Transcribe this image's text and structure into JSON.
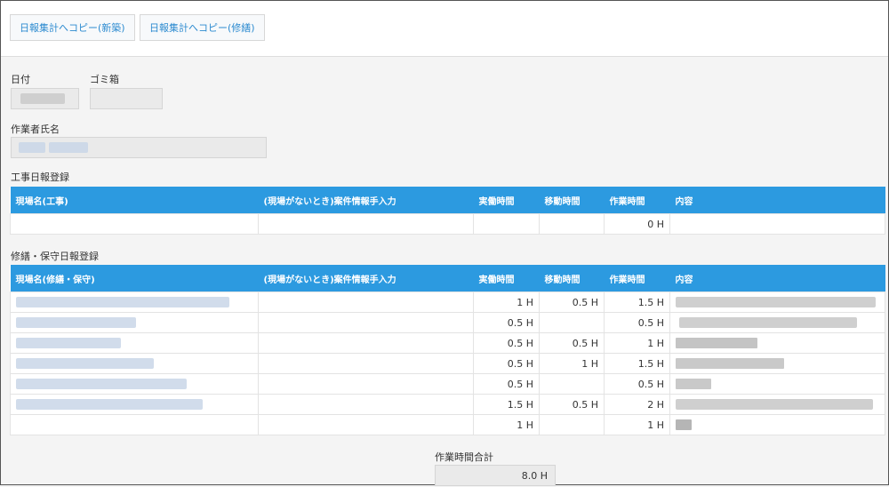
{
  "toolbar": {
    "copy_new_label": "日報集計へコピー(新築)",
    "copy_repair_label": "日報集計へコピー(修繕)"
  },
  "fields": {
    "date_label": "日付",
    "trash_label": "ゴミ箱",
    "worker_label": "作業者氏名"
  },
  "construction": {
    "section_title": "工事日報登録",
    "headers": [
      "現場名(工事)",
      "(現場がないとき)案件情報手入力",
      "実働時間",
      "移動時間",
      "作業時間",
      "内容"
    ],
    "rows": [
      {
        "site": "",
        "manual": "",
        "work": "",
        "move": "",
        "total": "0 H",
        "content": ""
      }
    ]
  },
  "repair": {
    "section_title": "修繕・保守日報登録",
    "headers": [
      "現場名(修繕・保守)",
      "(現場がないとき)案件情報手入力",
      "実働時間",
      "移動時間",
      "作業時間",
      "内容"
    ],
    "rows": [
      {
        "site": "",
        "manual": "",
        "work": "1 H",
        "move": "0.5 H",
        "total": "1.5 H",
        "content": ""
      },
      {
        "site": "",
        "manual": "",
        "work": "0.5 H",
        "move": "",
        "total": "0.5 H",
        "content": ""
      },
      {
        "site": "",
        "manual": "",
        "work": "0.5 H",
        "move": "0.5 H",
        "total": "1 H",
        "content": ""
      },
      {
        "site": "",
        "manual": "",
        "work": "0.5 H",
        "move": "1 H",
        "total": "1.5 H",
        "content": ""
      },
      {
        "site": "",
        "manual": "",
        "work": "0.5 H",
        "move": "",
        "total": "0.5 H",
        "content": ""
      },
      {
        "site": "",
        "manual": "",
        "work": "1.5 H",
        "move": "0.5 H",
        "total": "2 H",
        "content": ""
      },
      {
        "site": "",
        "manual": "",
        "work": "1 H",
        "move": "",
        "total": "1 H",
        "content": ""
      }
    ]
  },
  "summary": {
    "total_label": "作業時間合計",
    "total_value": "8.0 H"
  },
  "colors": {
    "header_blue": "#2c9ae0",
    "button_text": "#2d8bd0"
  }
}
